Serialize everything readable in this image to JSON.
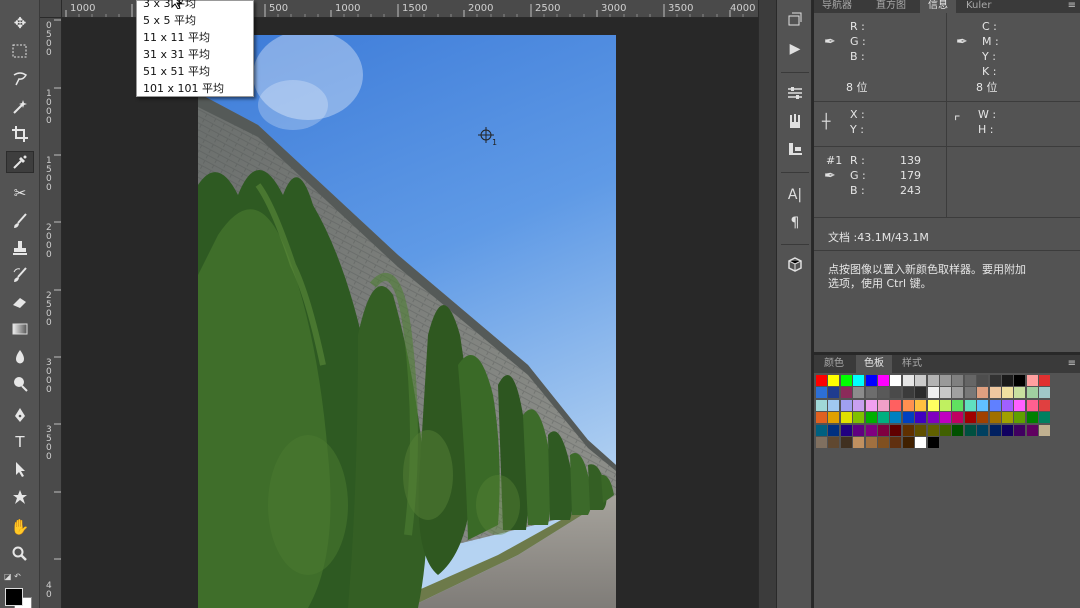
{
  "ruler_top": [
    "1000",
    "500",
    "1000",
    "1500",
    "2000",
    "2500",
    "3000",
    "3500",
    "4000"
  ],
  "ruler_left": [
    "0",
    "5",
    "0",
    "0",
    "1",
    "0",
    "0",
    "0",
    "1",
    "5",
    "0",
    "0",
    "2",
    "0",
    "0",
    "0",
    "2",
    "5",
    "0",
    "0",
    "3",
    "0",
    "0",
    "0",
    "3",
    "5",
    "0",
    "0",
    "4",
    "0"
  ],
  "sample_menu": {
    "items": [
      "3 x 3 平均",
      "5 x 5 平均",
      "11 x 11 平均",
      "31 x 31 平均",
      "51 x 51 平均",
      "101 x 101 平均"
    ]
  },
  "panel_tabs": {
    "tab1": "导航器",
    "tab2": "直方图",
    "tab3": "信息",
    "tab4": "Kuler"
  },
  "info": {
    "r": "R :",
    "g": "G :",
    "b": "B :",
    "c": "C :",
    "m": "M :",
    "y": "Y :",
    "k": "K :",
    "bits_left": "8 位",
    "bits_right": "8 位",
    "x": "X :",
    "y_coord": "Y :",
    "w": "W :",
    "h": "H :",
    "sampler_id": "#1",
    "s_r_label": "R :",
    "s_g_label": "G :",
    "s_b_label": "B :",
    "s_r": "139",
    "s_g": "179",
    "s_b": "243",
    "doc": "文档 :43.1M/43.1M",
    "hint1": "点按图像以置入新颜色取样器。要用附加",
    "hint2": "选项，使用  Ctrl 键。"
  },
  "swatch_tabs": {
    "tab1": "颜色",
    "tab2": "色板",
    "tab3": "样式"
  },
  "colors": {
    "sampler_color": "#8bb3f3"
  }
}
